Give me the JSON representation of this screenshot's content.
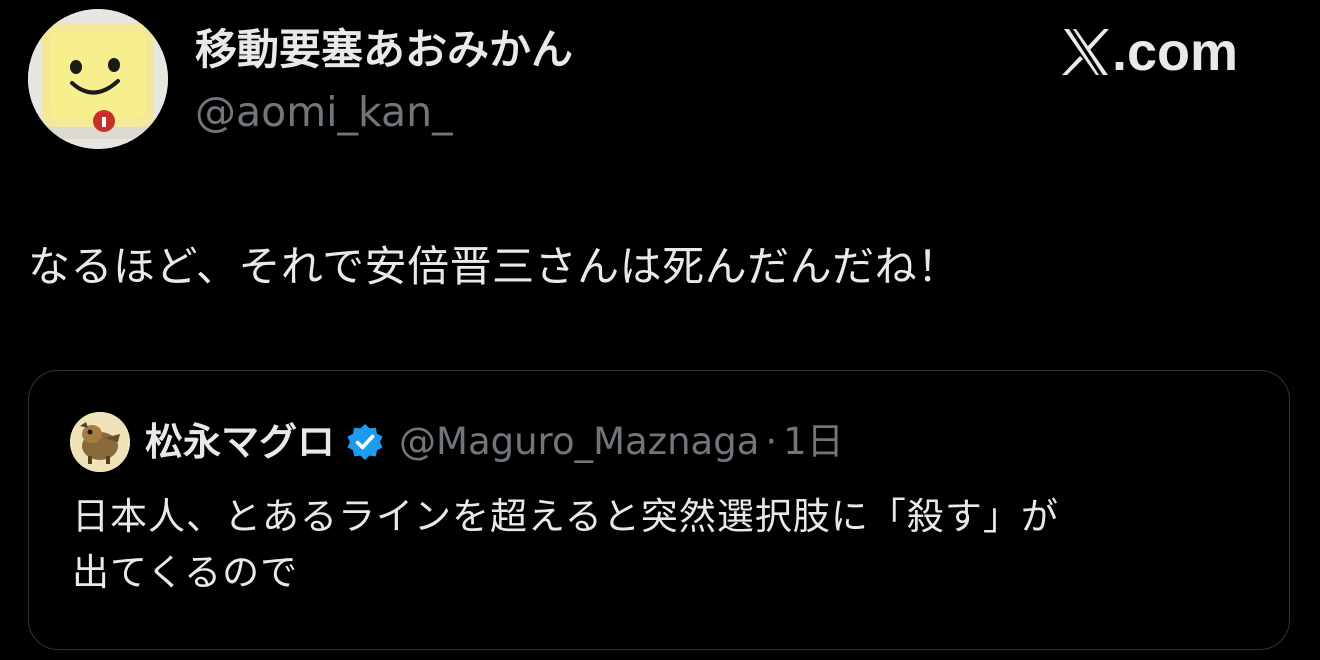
{
  "author": {
    "display_name": "移動要塞あおみかん",
    "handle": "@aomi_kan_",
    "avatar_icon": "smiling-cheese-avatar"
  },
  "brand": {
    "logo_icon": "x-logo-icon",
    "text": ".com"
  },
  "tweet": {
    "text": "なるほど、それで安倍晋三さんは死んだんだね！"
  },
  "quoted_tweet": {
    "avatar_icon": "quoted-user-avatar",
    "display_name": "松永マグロ",
    "verified_icon": "verified-badge-icon",
    "handle": "@Maguro_Maznaga",
    "separator": "·",
    "time": "1日",
    "text_lines": [
      "日本人、とあるラインを超えると突然選択肢に「殺す」が",
      "出てくるので"
    ]
  },
  "colors": {
    "background": "#000000",
    "primary_text": "#e7e9ea",
    "secondary_text": "#71767b",
    "border": "#2f3336",
    "verified_blue": "#1d9bf0"
  }
}
